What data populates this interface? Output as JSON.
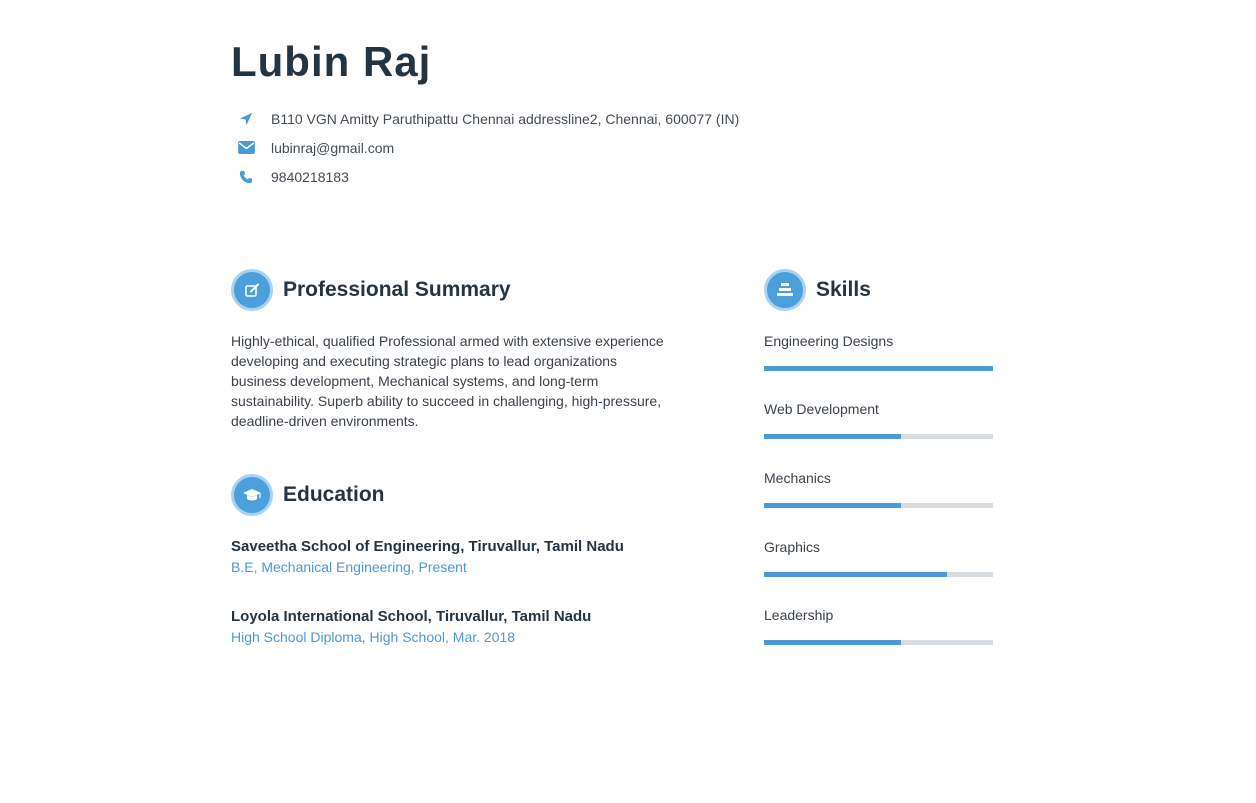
{
  "header": {
    "name": "Lubin Raj",
    "address": "B110 VGN Amitty Paruthipattu Chennai addressline2, Chennai, 600077 (IN)",
    "email": "lubinraj@gmail.com",
    "phone": "9840218183"
  },
  "summary": {
    "title": "Professional Summary",
    "text": "Highly-ethical, qualified  Professional armed with extensive experience developing and executing strategic plans to lead organizations business development, Mechanical systems, and long-term sustainability.  Superb ability to succeed in challenging, high-pressure, deadline-driven environments."
  },
  "education": {
    "title": "Education",
    "items": [
      {
        "school": "Saveetha School of Engineering, Tiruvallur, Tamil Nadu",
        "degree": "B.E, Mechanical Engineering, Present"
      },
      {
        "school": "Loyola International School, Tiruvallur, Tamil Nadu",
        "degree": "High School Diploma, High School, Mar. 2018"
      }
    ]
  },
  "skills": {
    "title": "Skills",
    "items": [
      {
        "name": "Engineering Designs",
        "level": 1.0
      },
      {
        "name": "Web Development",
        "level": 0.6
      },
      {
        "name": "Mechanics",
        "level": 0.6
      },
      {
        "name": "Graphics",
        "level": 0.8
      },
      {
        "name": "Leadership",
        "level": 0.6
      }
    ]
  },
  "colors": {
    "accent": "#4a9ad6",
    "accent_light": "#a9d3f2",
    "heading": "#253441",
    "bar_track": "#d7dce1"
  },
  "icons": {
    "address": "location-arrow-icon",
    "email": "envelope-icon",
    "phone": "phone-icon",
    "summary": "edit-icon",
    "education": "graduation-cap-icon",
    "skills": "skills-bars-icon"
  }
}
